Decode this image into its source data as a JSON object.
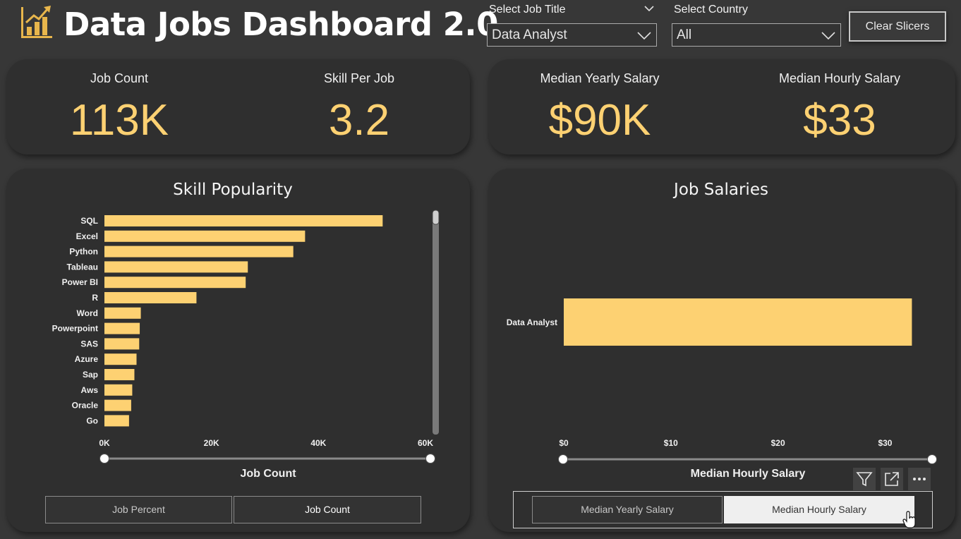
{
  "header": {
    "title": "Data Jobs Dashboard 2.0",
    "logo_icon": "bar-chart-growth-icon",
    "accent_color": "#fdd172"
  },
  "slicers": {
    "job_title": {
      "label": "Select Job Title",
      "value": "Data Analyst"
    },
    "country": {
      "label": "Select Country",
      "value": "All"
    },
    "clear_label": "Clear Slicers"
  },
  "kpis": {
    "job_count": {
      "label": "Job Count",
      "value": "113K"
    },
    "skill_per_job": {
      "label": "Skill Per Job",
      "value": "3.2"
    },
    "median_yearly": {
      "label": "Median Yearly Salary",
      "value": "$90K"
    },
    "median_hourly": {
      "label": "Median Hourly Salary",
      "value": "$33"
    }
  },
  "skill_popularity": {
    "title": "Skill Popularity",
    "toggle": {
      "left": "Job Percent",
      "right": "Job Count",
      "selected": "Job Count"
    }
  },
  "job_salaries": {
    "title": "Job Salaries",
    "toggle": {
      "left": "Median Yearly Salary",
      "right": "Median Hourly Salary",
      "selected": "Median Hourly Salary"
    }
  },
  "chart_data": [
    {
      "type": "bar",
      "orientation": "horizontal",
      "title": "Skill Popularity",
      "categories": [
        "SQL",
        "Excel",
        "Python",
        "Tableau",
        "Power BI",
        "R",
        "Word",
        "Powerpoint",
        "SAS",
        "Azure",
        "Sap",
        "Aws",
        "Oracle",
        "Go"
      ],
      "values": [
        52000,
        37500,
        35300,
        26800,
        26400,
        17200,
        6800,
        6600,
        6500,
        6000,
        5600,
        5200,
        5000,
        4600
      ],
      "xlabel": "Job Count",
      "xlim": [
        0,
        60000
      ],
      "xticks": [
        "0K",
        "20K",
        "40K",
        "60K"
      ],
      "color": "#fdd172"
    },
    {
      "type": "bar",
      "orientation": "horizontal",
      "title": "Job Salaries",
      "categories": [
        "Data Analyst"
      ],
      "values": [
        32.5
      ],
      "xlabel": "Median Hourly Salary",
      "xlim": [
        0,
        33
      ],
      "xticks": [
        "$0",
        "$10",
        "$20",
        "$30"
      ],
      "color": "#fdd172"
    }
  ]
}
